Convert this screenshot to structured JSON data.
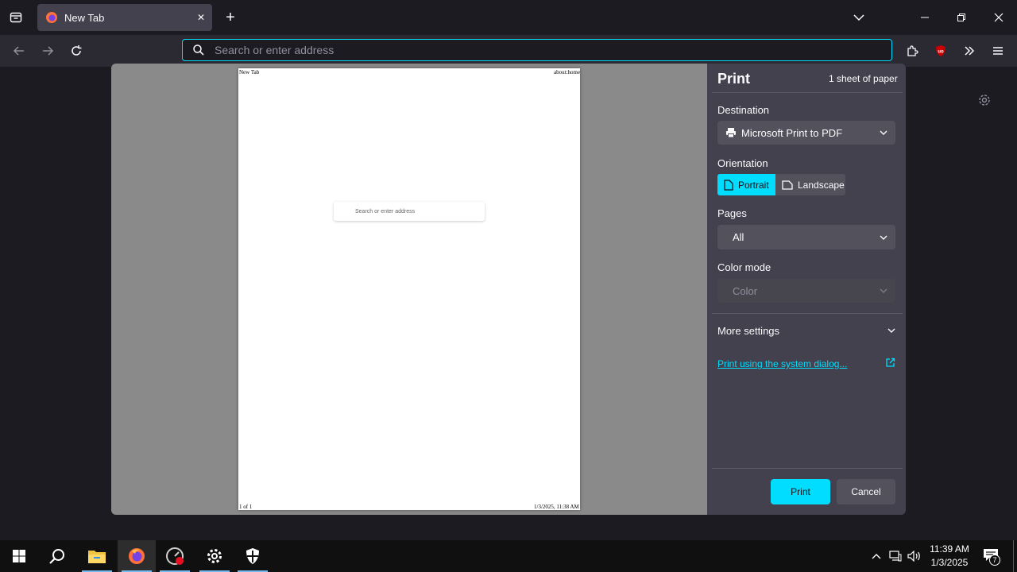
{
  "browser": {
    "tab": {
      "title": "New Tab",
      "close": "✕"
    },
    "new_tab": "+",
    "urlbar": {
      "placeholder": "Search or enter address",
      "value": ""
    }
  },
  "preview": {
    "header_left": "New Tab",
    "header_right": "about:home",
    "footer_left": "1 of 1",
    "footer_right": "1/3/2025, 11:38 AM",
    "search_placeholder": "Search or enter address"
  },
  "print": {
    "title": "Print",
    "sheets": "1 sheet of paper",
    "destination_label": "Destination",
    "destination_value": "Microsoft Print to PDF",
    "orientation_label": "Orientation",
    "orientation_portrait": "Portrait",
    "orientation_landscape": "Landscape",
    "pages_label": "Pages",
    "pages_value": "All",
    "color_label": "Color mode",
    "color_value": "Color",
    "more_settings": "More settings",
    "system_dialog": "Print using the system dialog...",
    "print_button": "Print",
    "cancel_button": "Cancel"
  },
  "taskbar": {
    "time": "11:39 AM",
    "date": "1/3/2025",
    "notification_count": "7"
  },
  "colors": {
    "accent": "#00ddff",
    "panel": "#42414d",
    "toolbar": "#2b2a33"
  }
}
